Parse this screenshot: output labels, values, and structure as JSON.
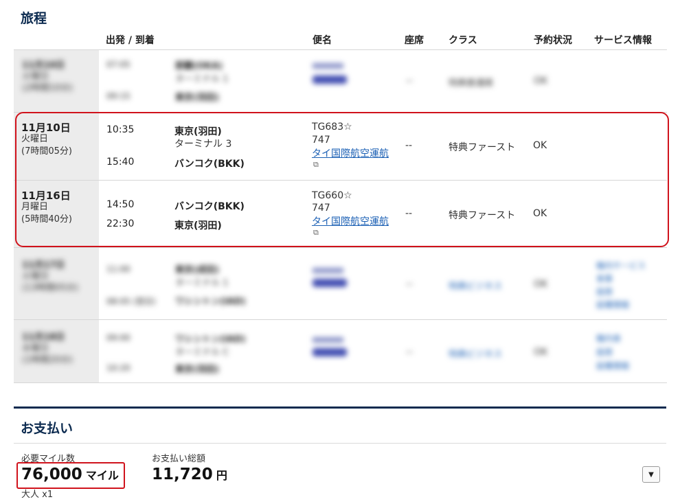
{
  "itinerary": {
    "title": "旅程",
    "headers": {
      "dep_arr": "出発 / 到着",
      "flight": "便名",
      "seat": "座席",
      "class": "クラス",
      "status": "予約状況",
      "service": "サービス情報"
    },
    "blurred_row_1": {
      "date": "11月10日",
      "weekday": "火曜日",
      "duration": "(2時間10分)",
      "dep_time": "07:05",
      "arr_time": "09:15",
      "dep_city": "那覇(OKA)",
      "dep_terminal": "ターミナル 1",
      "arr_city": "東京(羽田)",
      "seat": "--",
      "class": "特典普通席",
      "status": "OK"
    },
    "segments": [
      {
        "date": "11月10日",
        "weekday": "火曜日",
        "duration": "(7時間05分)",
        "dep_time": "10:35",
        "dep_city": "東京(羽田)",
        "dep_terminal": "ターミナル 3",
        "arr_time": "15:40",
        "arr_city": "バンコク(BKK)",
        "flight_no": "TG683",
        "aircraft": "747",
        "operator": "タイ国際航空運航",
        "seat": "--",
        "class": "特典ファースト",
        "status": "OK"
      },
      {
        "date": "11月16日",
        "weekday": "月曜日",
        "duration": "(5時間40分)",
        "dep_time": "14:50",
        "dep_city": "バンコク(BKK)",
        "arr_time": "22:30",
        "arr_city": "東京(羽田)",
        "flight_no": "TG660",
        "aircraft": "747",
        "operator": "タイ国際航空運航",
        "seat": "--",
        "class": "特典ファースト",
        "status": "OK"
      }
    ],
    "blurred_row_2": {
      "date": "11月17日",
      "weekday": "火曜日",
      "duration": "(13時間05分)",
      "dep_time": "11:00",
      "arr_time": "08:05 (翌日)",
      "dep_city": "東京(成田)",
      "dep_terminal": "ターミナル 1",
      "arr_city": "ワシントン(IAD)",
      "seat": "--",
      "class": "特典ビジネス",
      "status": "OK",
      "service": [
        "機内サービス",
        "食事",
        "座席",
        "設備情報"
      ]
    },
    "blurred_row_3": {
      "date": "11月18日",
      "weekday": "水曜日",
      "duration": "(1時間20分)",
      "dep_time": "09:00",
      "arr_time": "10:20",
      "dep_city": "ワシントン(IAD)",
      "dep_terminal": "ターミナル C",
      "arr_city": "東京(羽田)",
      "seat": "--",
      "class": "特典ビジネス",
      "status": "OK",
      "service": [
        "機内食",
        "座席",
        "設備情報"
      ]
    }
  },
  "payment": {
    "title": "お支払い",
    "miles_label": "必要マイル数",
    "miles_value": "76,000",
    "miles_unit": "マイル",
    "pax": "大人 x1",
    "total_label": "お支払い総額",
    "total_value": "11,720",
    "total_unit": "円"
  },
  "icons": {
    "star": "☆",
    "external": "⧉",
    "dropdown": "▼"
  },
  "colors": {
    "navy": "#0b2a4f",
    "highlight_red": "#d0121b",
    "link_blue": "#1a5fb4"
  }
}
